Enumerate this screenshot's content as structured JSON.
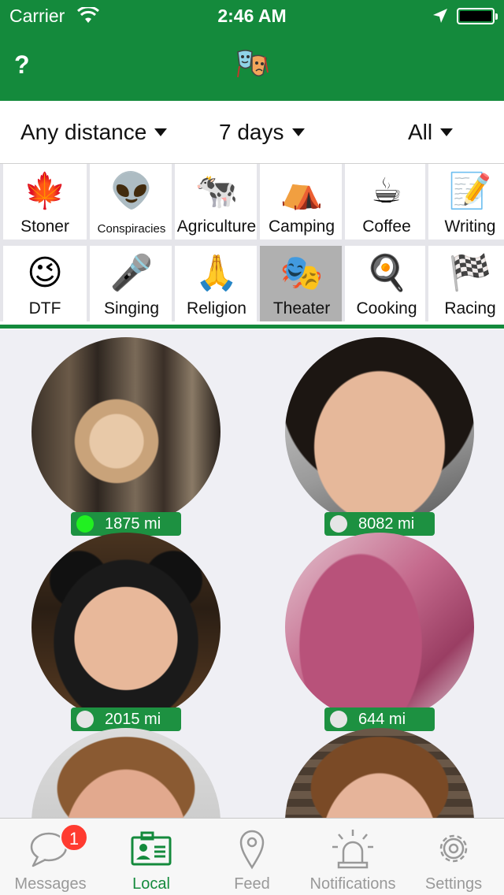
{
  "status_bar": {
    "carrier": "Carrier",
    "time": "2:46 AM"
  },
  "nav": {
    "help_label": "?",
    "logo_icon": "theater-masks-icon"
  },
  "filters": [
    {
      "label": "Any distance"
    },
    {
      "label": "7 days"
    },
    {
      "label": "All"
    }
  ],
  "interests": {
    "row1": [
      {
        "label": "Stoner",
        "icon": "🍁"
      },
      {
        "label": "Conspiracies",
        "icon": "👽"
      },
      {
        "label": "Agriculture",
        "icon": "🐄"
      },
      {
        "label": "Camping",
        "icon": "⛺"
      },
      {
        "label": "Coffee",
        "icon": "☕"
      },
      {
        "label": "Writing",
        "icon": "📝"
      }
    ],
    "row2": [
      {
        "label": "DTF",
        "icon": "😉"
      },
      {
        "label": "Singing",
        "icon": "🎤"
      },
      {
        "label": "Religion",
        "icon": "🙏"
      },
      {
        "label": "Theater",
        "icon": "🎭"
      },
      {
        "label": "Cooking",
        "icon": "🍳"
      },
      {
        "label": "Racing",
        "icon": "🏁"
      }
    ],
    "selected": "Theater"
  },
  "profiles": [
    {
      "distance": "1875 mi",
      "online": true
    },
    {
      "distance": "8082 mi",
      "online": false
    },
    {
      "distance": "2015 mi",
      "online": false
    },
    {
      "distance": "644 mi",
      "online": false
    },
    {
      "distance": "",
      "online": false
    },
    {
      "distance": "",
      "online": false
    }
  ],
  "tabbar": {
    "tabs": [
      {
        "label": "Messages",
        "badge": "1"
      },
      {
        "label": "Local"
      },
      {
        "label": "Feed"
      },
      {
        "label": "Notifications"
      },
      {
        "label": "Settings"
      }
    ],
    "active": "Local"
  },
  "colors": {
    "brand_green": "#148a3c",
    "online_dot": "#21f021",
    "badge_red": "#ff3b30"
  }
}
